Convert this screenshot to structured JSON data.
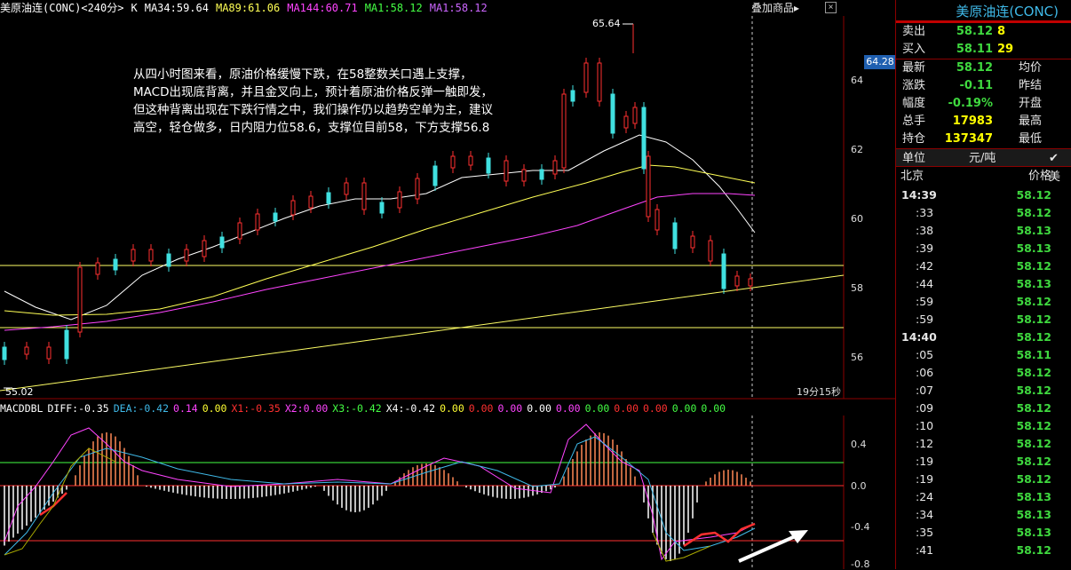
{
  "chart_header": {
    "symbol": "美原油连(CONC)<240分>",
    "type": "K",
    "ma34": "MA34:59.64",
    "ma89": "MA89:61.06",
    "ma144": "MA144:60.71",
    "ma1a": "MA1:58.12",
    "ma1b": "MA1:58.12",
    "overlay": "叠加商品",
    "overlay_arrow": "▸",
    "close": "×"
  },
  "colors": {
    "up": "#ff3030",
    "down": "#40e0e0",
    "ma34": "#ffffff",
    "ma89": "#ffff55",
    "ma144": "#ff44ff",
    "ma1a": "#44ff44",
    "ma1b": "#cc66ff",
    "hline": "#ffff66",
    "price_green": "#3fd93f"
  },
  "price_axis": [
    "64",
    "62",
    "60",
    "58",
    "56"
  ],
  "latest_price_tag": "64.28",
  "high_label": "65.64",
  "low_label": "55.02",
  "timer": "19分15秒",
  "annotation": [
    "从四小时图来看，原油价格缓慢下跌，在58整数关口遇上支撑，",
    "MACD出现底背离，并且金叉向上，预计着原油价格反弹一触即发，",
    "但这种背离出现在下跌行情之中，我们操作仍以趋势空单为主，建议",
    "高空，轻仓做多，日内阻力位58.6，支撑位目前58，下方支撑56.8"
  ],
  "macd_header": [
    {
      "text": "MACDDBL",
      "color": "#ffffff"
    },
    {
      "text": "DIFF:-0.35",
      "color": "#ffffff"
    },
    {
      "text": "DEA:-0.42",
      "color": "#3fb9e8"
    },
    {
      "text": "0.14",
      "color": "#ff44ff"
    },
    {
      "text": "0.00",
      "color": "#ffff33"
    },
    {
      "text": "X1:-0.35",
      "color": "#ff3030"
    },
    {
      "text": "X2:0.00",
      "color": "#ff44ff"
    },
    {
      "text": "X3:-0.42",
      "color": "#44ff44"
    },
    {
      "text": "X4:-0.42",
      "color": "#ffffff"
    },
    {
      "text": "0.00",
      "color": "#ffff33"
    },
    {
      "text": "0.00",
      "color": "#ff3030"
    },
    {
      "text": "0.00",
      "color": "#ff44ff"
    },
    {
      "text": "0.00",
      "color": "#ffffff"
    },
    {
      "text": "0.00",
      "color": "#ff44ff"
    },
    {
      "text": "0.00",
      "color": "#44ff44"
    },
    {
      "text": "0.00",
      "color": "#ff3030"
    },
    {
      "text": "0.00",
      "color": "#ff3030"
    },
    {
      "text": "0.00",
      "color": "#44ff44"
    },
    {
      "text": "0.00",
      "color": "#44ff44"
    }
  ],
  "macd_axis": [
    "0.4",
    "0.0",
    "-0.4",
    "-0.8"
  ],
  "quote": {
    "title": "美原油连(CONC)",
    "sell_label": "卖出",
    "sell_price": "58.12",
    "sell_vol": "8",
    "buy_label": "买入",
    "buy_price": "58.11",
    "buy_vol": "29",
    "rows": [
      {
        "l1": "最新",
        "v": "58.12",
        "vc": "#3fd93f",
        "l2": "均价"
      },
      {
        "l1": "涨跌",
        "v": "-0.11",
        "vc": "#3fd93f",
        "l2": "昨结"
      },
      {
        "l1": "幅度",
        "v": "-0.19%",
        "vc": "#3fd93f",
        "l2": "开盘"
      },
      {
        "l1": "总手",
        "v": "17983",
        "vc": "#ffff00",
        "l2": "最高"
      },
      {
        "l1": "持仓",
        "v": "137347",
        "vc": "#ffff00",
        "l2": "最低"
      }
    ],
    "unit_label": "单位",
    "unit_value": "元/吨",
    "unit_check": "✔ 美",
    "ticks_col1": "北京",
    "ticks_col2": "价格",
    "ticks": [
      {
        "t": "14:39",
        "p": "58.12",
        "main": true
      },
      {
        "t": ":33",
        "p": "58.12"
      },
      {
        "t": ":38",
        "p": "58.13"
      },
      {
        "t": ":39",
        "p": "58.13"
      },
      {
        "t": ":42",
        "p": "58.12"
      },
      {
        "t": ":44",
        "p": "58.13"
      },
      {
        "t": ":59",
        "p": "58.12"
      },
      {
        "t": ":59",
        "p": "58.12"
      },
      {
        "t": "14:40",
        "p": "58.12",
        "main": true
      },
      {
        "t": ":05",
        "p": "58.11"
      },
      {
        "t": ":06",
        "p": "58.12"
      },
      {
        "t": ":07",
        "p": "58.12"
      },
      {
        "t": ":09",
        "p": "58.12"
      },
      {
        "t": ":10",
        "p": "58.12"
      },
      {
        "t": ":12",
        "p": "58.12"
      },
      {
        "t": ":19",
        "p": "58.12"
      },
      {
        "t": ":19",
        "p": "58.12"
      },
      {
        "t": ":24",
        "p": "58.13"
      },
      {
        "t": ":34",
        "p": "58.13"
      },
      {
        "t": ":35",
        "p": "58.13"
      },
      {
        "t": ":41",
        "p": "58.12"
      }
    ]
  }
}
